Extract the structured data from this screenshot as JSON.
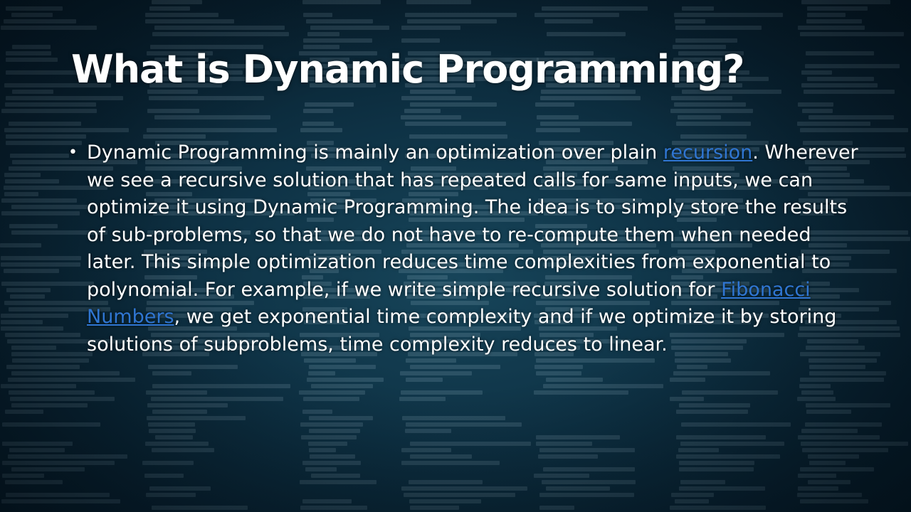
{
  "slide": {
    "title": "What is Dynamic Programming?",
    "bullet": {
      "part1": "Dynamic Programming is mainly an optimization over plain ",
      "link1": "recursion",
      "part2": ". Wherever we see a recursive solution that has repeated calls for same inputs, we can optimize it using Dynamic Programming. The idea is to simply store the results of sub-problems, so that we do not have to re-compute them when needed later. This simple optimization reduces time complexities from exponential to polynomial. For example, if we write simple recursive solution for ",
      "link2": "Fibonacci Numbers",
      "part3": ", we get exponential time complexity and if we optimize it by storing solutions of subproblems, time complexity reduces to linear."
    }
  },
  "colors": {
    "background": "#0e3245",
    "text": "#ffffff",
    "link": "#2f76d2"
  }
}
